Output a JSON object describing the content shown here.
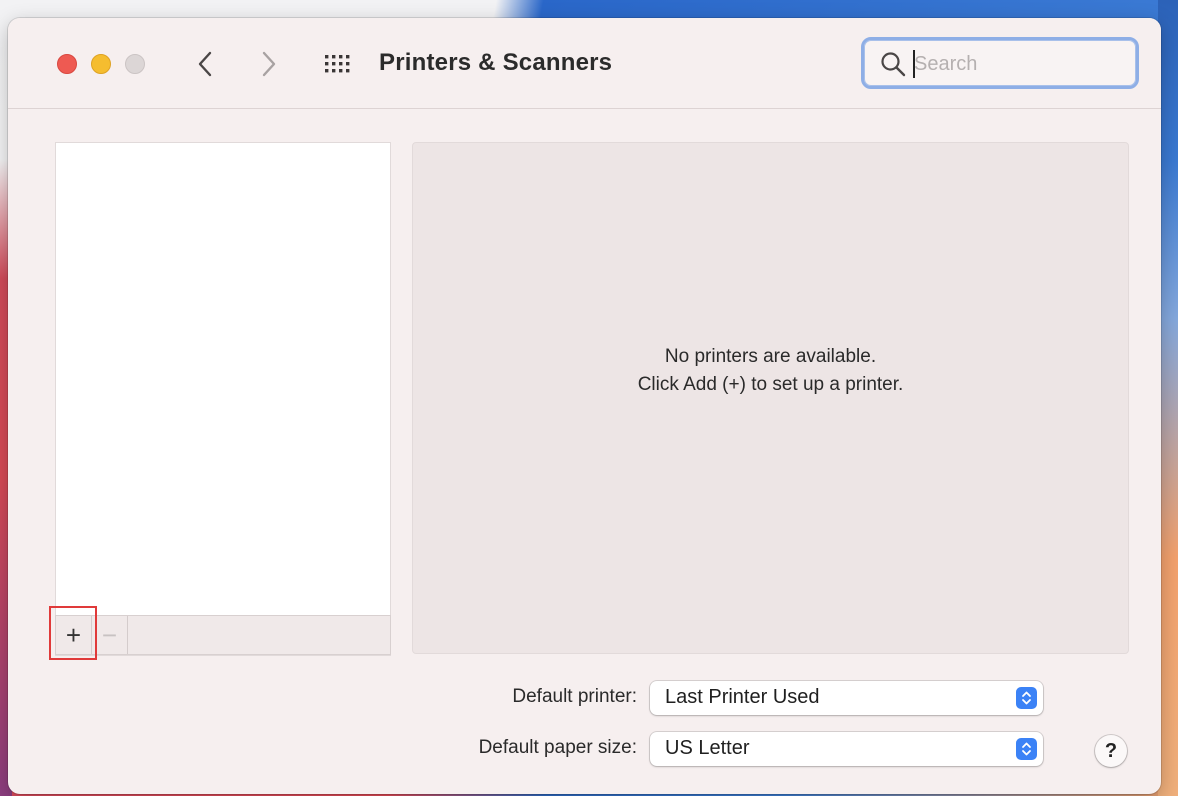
{
  "window": {
    "title": "Printers & Scanners"
  },
  "search": {
    "placeholder": "Search",
    "value": ""
  },
  "printer_list": {
    "items": [],
    "add_label": "+",
    "remove_label": "−"
  },
  "detail": {
    "empty_line1": "No printers are available.",
    "empty_line2": "Click Add (+) to set up a printer."
  },
  "settings": {
    "default_printer_label": "Default printer:",
    "default_printer_value": "Last Printer Used",
    "default_paper_label": "Default paper size:",
    "default_paper_value": "US Letter"
  },
  "help": {
    "label": "?"
  },
  "icons": {
    "close": "close-dot",
    "minimize": "minimize-dot",
    "zoom": "zoom-dot",
    "back": "chevron-left",
    "forward": "chevron-right",
    "show_all": "grid-dots",
    "search": "magnifier",
    "popup": "up-down-chevrons"
  },
  "colors": {
    "close": "#ee5a52",
    "minimize": "#f5bd2f",
    "zoom_inactive": "#dcd6d6",
    "accent": "#3b82f6",
    "focus_ring": "#8eaee6",
    "highlight": "#e03a3a"
  }
}
